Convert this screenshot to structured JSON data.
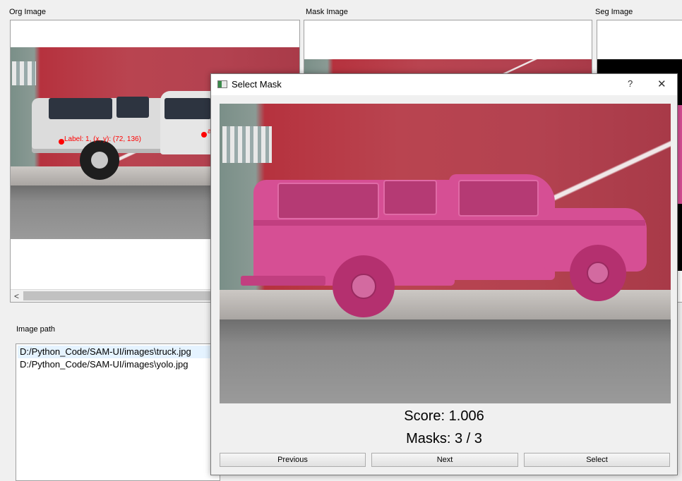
{
  "panels": {
    "org_label": "Org Image",
    "mask_label": "Mask Image",
    "seg_label": "Seg Image"
  },
  "annotations": {
    "point1_text": "Label: 1, (x, y): (72, 136)",
    "point2_text": "a"
  },
  "scrollbar": {
    "left_arrow": "<"
  },
  "image_path": {
    "label": "Image path",
    "items": [
      "D:/Python_Code/SAM-UI/images\\truck.jpg",
      "D:/Python_Code/SAM-UI/images\\yolo.jpg"
    ],
    "selected_index": 0
  },
  "dialog": {
    "title": "Select Mask",
    "help": "?",
    "close": "✕",
    "score": "Score: 1.006",
    "masks": "Masks: 3 / 3",
    "buttons": {
      "previous": "Previous",
      "next": "Next",
      "select": "Select"
    }
  },
  "colors": {
    "mask_pink": "#d64f94",
    "annotation_red": "#ff0000",
    "list_selected": "#e5f3ff"
  }
}
